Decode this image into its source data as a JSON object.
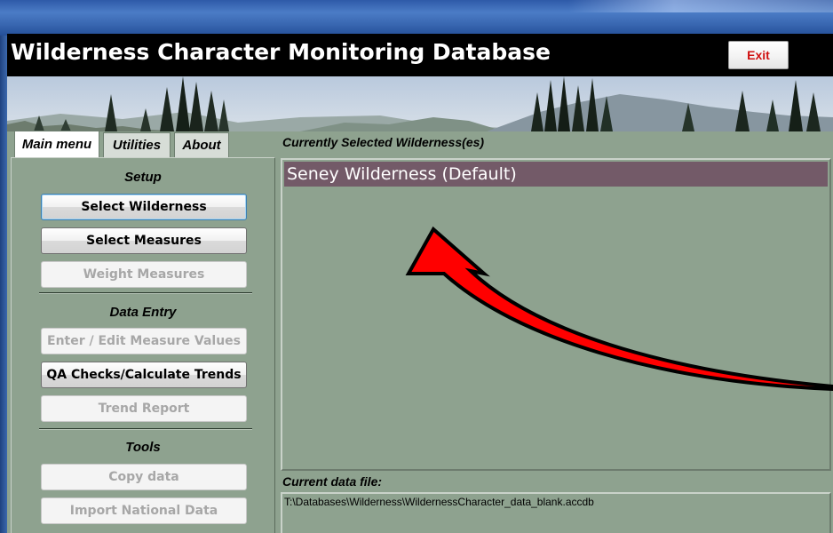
{
  "header": {
    "title": "Wilderness Character Monitoring Database",
    "exit_label": "Exit"
  },
  "tabs": [
    {
      "label": "Main menu",
      "selected": true
    },
    {
      "label": "Utilities",
      "selected": false
    },
    {
      "label": "About",
      "selected": false
    }
  ],
  "sidebar": {
    "setup_heading": "Setup",
    "data_entry_heading": "Data Entry",
    "tools_heading": "Tools",
    "buttons": {
      "select_wilderness": {
        "label": "Select Wilderness",
        "enabled": true
      },
      "select_measures": {
        "label": "Select Measures",
        "enabled": true
      },
      "weight_measures": {
        "label": "Weight Measures",
        "enabled": false
      },
      "enter_edit_values": {
        "label": "Enter / Edit Measure Values",
        "enabled": false
      },
      "qa_checks": {
        "label": "QA Checks/Calculate Trends",
        "enabled": true
      },
      "trend_report": {
        "label": "Trend Report",
        "enabled": false
      },
      "copy_data": {
        "label": "Copy data",
        "enabled": false
      },
      "import_national": {
        "label": "Import National Data",
        "enabled": false
      }
    }
  },
  "main": {
    "selected_label": "Currently Selected Wilderness(es)",
    "wilderness_list": [
      "Seney Wilderness (Default)"
    ],
    "datafile_label": "Current data file:",
    "datafile_path": "T:\\Databases\\Wilderness\\WildernessCharacter_data_blank.accdb"
  },
  "colors": {
    "panel_background": "#8ea28f",
    "selected_row": "#735a68",
    "exit_text": "#d01010",
    "annotation_arrow": "#ff0000"
  }
}
